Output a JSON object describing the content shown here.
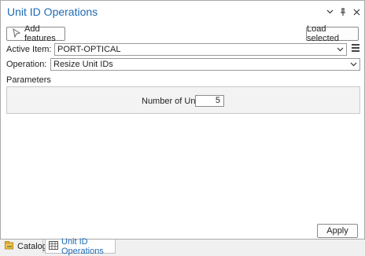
{
  "pane": {
    "title": "Unit ID Operations",
    "controls": [
      "chevron-down-icon",
      "pin-icon",
      "close-icon"
    ]
  },
  "toolbar": {
    "add_features_label": "Add features",
    "load_selected_label": "Load selected"
  },
  "active_item": {
    "label": "Active Item:",
    "value": "PORT-OPTICAL"
  },
  "operation": {
    "label": "Operation:",
    "value": "Resize Unit IDs"
  },
  "parameters": {
    "heading": "Parameters",
    "number_of_units_label": "Number of Units:",
    "number_of_units_value": "5"
  },
  "footer": {
    "apply_label": "Apply"
  },
  "tabs": [
    {
      "label": "Catalog",
      "active": false
    },
    {
      "label": "Unit ID Operations",
      "active": true
    }
  ],
  "colors": {
    "accent": "#1d6bb5"
  }
}
